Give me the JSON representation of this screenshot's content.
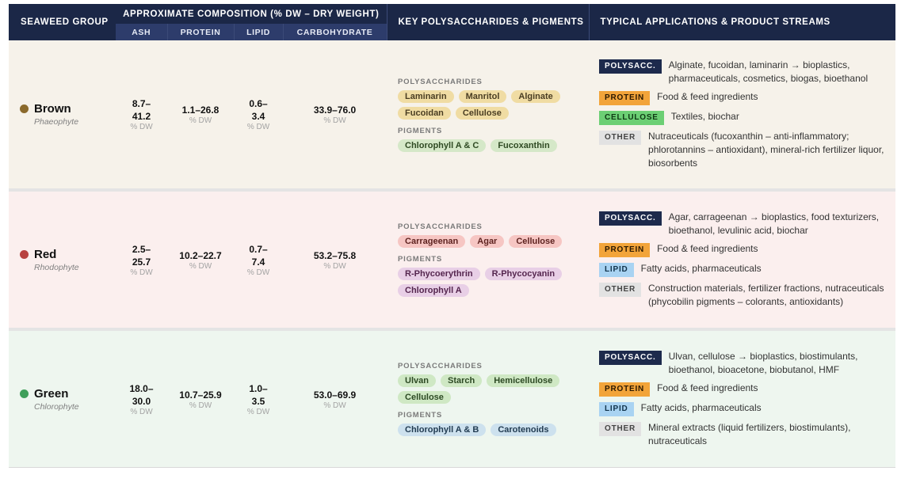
{
  "header": {
    "group": "SEAWEED GROUP",
    "composition": "APPROXIMATE COMPOSITION (% DW – DRY WEIGHT)",
    "key": "KEY POLYSACCHARIDES & PIGMENTS",
    "apps": "TYPICAL APPLICATIONS & PRODUCT STREAMS",
    "sub": [
      "ASH",
      "PROTEIN",
      "LIPID",
      "CARBOHYDRATE"
    ]
  },
  "labels": {
    "polysaccharides": "POLYSACCHARIDES",
    "pigments": "PIGMENTS",
    "unit": "% DW"
  },
  "colors": {
    "brown": "#8b6a2c",
    "red": "#b8413f",
    "green": "#3f9f5a",
    "header": "#1b2747"
  },
  "rows": [
    {
      "name": "Brown",
      "latin": "Phaeophyte",
      "ash": [
        "8.7–",
        "41.2"
      ],
      "protein": [
        "1.1–26.8"
      ],
      "lipid": [
        "0.6–",
        "3.4"
      ],
      "carbohydrate": [
        "33.9–76.0"
      ],
      "polysaccharides": [
        "Laminarin",
        "Manritol",
        "Alginate",
        "Fucoidan",
        "Cellulose"
      ],
      "pigments": [
        "Chlorophyll A & C",
        "Fucoxanthin"
      ],
      "applications": [
        {
          "badge": "POLYSACC.",
          "type": "polysacc",
          "text": "Alginate, fucoidan, laminarin → bioplastics, pharmaceuticals, cosmetics, biogas, bioethanol"
        },
        {
          "badge": "PROTEIN",
          "type": "protein",
          "text": "Food & feed ingredients"
        },
        {
          "badge": "CELLULOSE",
          "type": "cellulose",
          "text": "Textiles, biochar"
        },
        {
          "badge": "OTHER",
          "type": "other",
          "text": "Nutraceuticals (fucoxanthin – anti-inflammatory; phlorotannins – antioxidant), mineral-rich fertilizer liquor, biosorbents"
        }
      ]
    },
    {
      "name": "Red",
      "latin": "Rhodophyte",
      "ash": [
        "2.5–",
        "25.7"
      ],
      "protein": [
        "10.2–22.7"
      ],
      "lipid": [
        "0.7–",
        "7.4"
      ],
      "carbohydrate": [
        "53.2–75.8"
      ],
      "polysaccharides": [
        "Carrageenan",
        "Agar",
        "Cellulose"
      ],
      "pigments": [
        "R-Phycoerythrin",
        "R-Phycocyanin",
        "Chlorophyll A"
      ],
      "applications": [
        {
          "badge": "POLYSACC.",
          "type": "polysacc",
          "text": "Agar, carrageenan → bioplastics, food texturizers, bioethanol, levulinic acid, biochar"
        },
        {
          "badge": "PROTEIN",
          "type": "protein",
          "text": "Food & feed ingredients"
        },
        {
          "badge": "LIPID",
          "type": "lipid",
          "text": "Fatty acids, pharmaceuticals"
        },
        {
          "badge": "OTHER",
          "type": "other",
          "text": "Construction materials, fertilizer fractions, nutraceuticals (phycobilin pigments – colorants, antioxidants)"
        }
      ]
    },
    {
      "name": "Green",
      "latin": "Chlorophyte",
      "ash": [
        "18.0–",
        "30.0"
      ],
      "protein": [
        "10.7–25.9"
      ],
      "lipid": [
        "1.0–",
        "3.5"
      ],
      "carbohydrate": [
        "53.0–69.9"
      ],
      "polysaccharides": [
        "Ulvan",
        "Starch",
        "Hemicellulose",
        "Cellulose"
      ],
      "pigments": [
        "Chlorophyll A & B",
        "Carotenoids"
      ],
      "applications": [
        {
          "badge": "POLYSACC.",
          "type": "polysacc",
          "text": "Ulvan, cellulose → bioplastics, biostimulants, bioethanol, bioacetone, biobutanol, HMF"
        },
        {
          "badge": "PROTEIN",
          "type": "protein",
          "text": "Food & feed ingredients"
        },
        {
          "badge": "LIPID",
          "type": "lipid",
          "text": "Fatty acids, pharmaceuticals"
        },
        {
          "badge": "OTHER",
          "type": "other",
          "text": "Mineral extracts (liquid fertilizers, biostimulants), nutraceuticals"
        }
      ]
    }
  ]
}
